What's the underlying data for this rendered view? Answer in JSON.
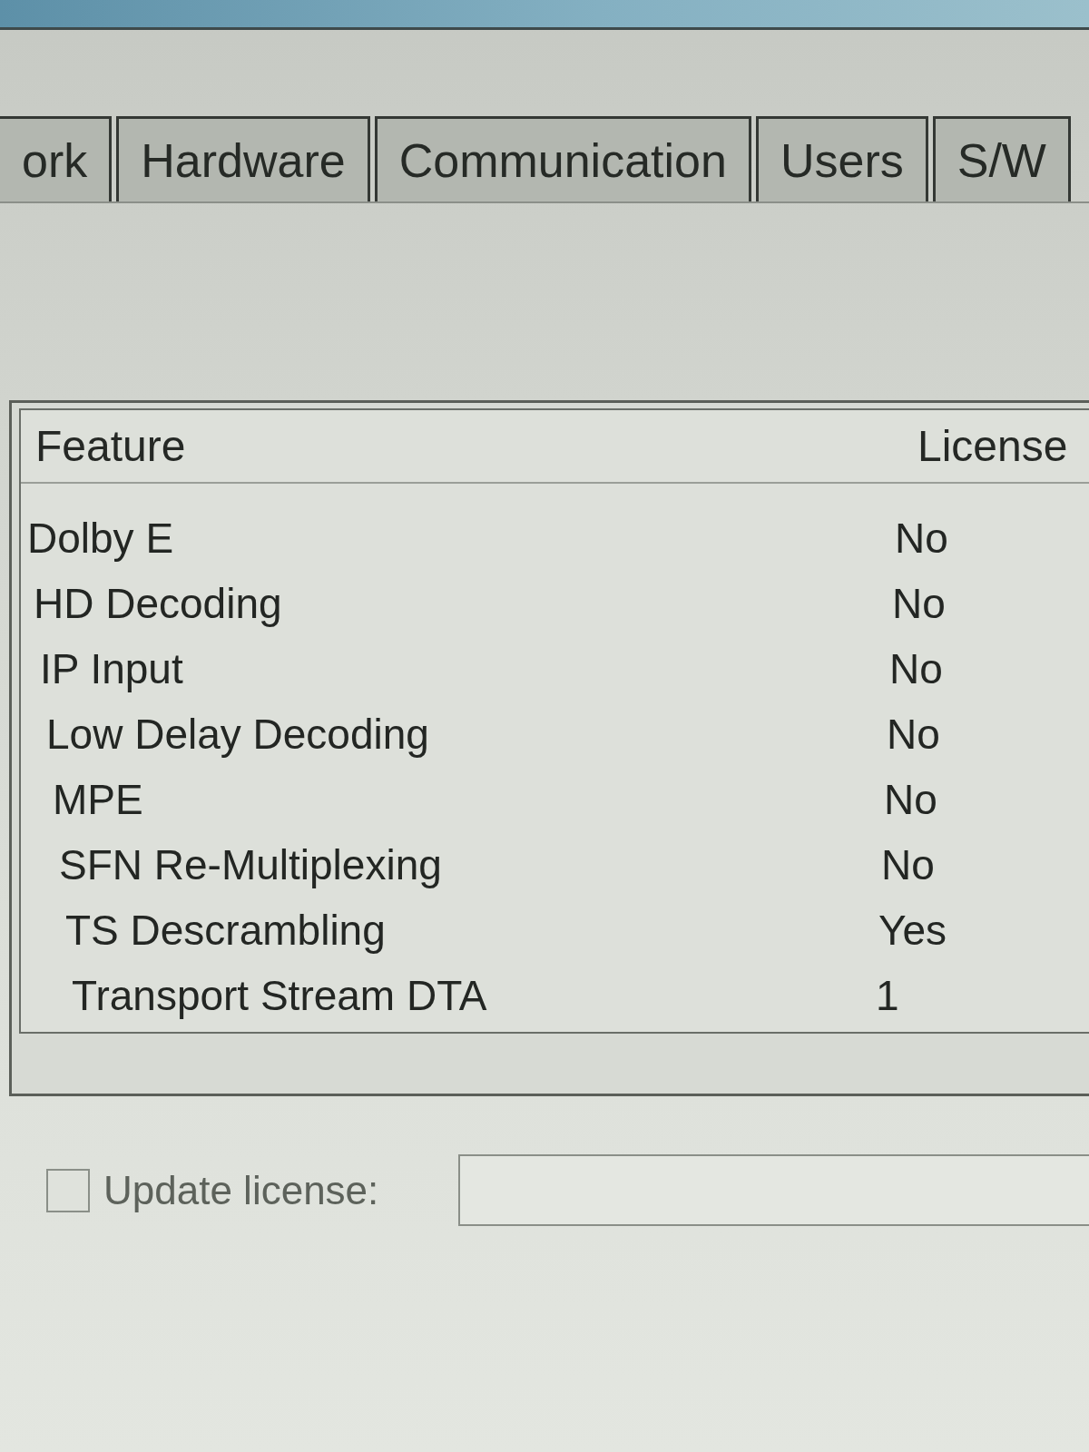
{
  "tabs": [
    {
      "label": "ork"
    },
    {
      "label": "Hardware"
    },
    {
      "label": "Communication"
    },
    {
      "label": "Users"
    },
    {
      "label": "S/W"
    }
  ],
  "features_table": {
    "columns": [
      "Feature",
      "License"
    ],
    "rows": [
      [
        "Dolby E",
        "No"
      ],
      [
        "HD Decoding",
        "No"
      ],
      [
        "IP Input",
        "No"
      ],
      [
        "Low Delay Decoding",
        "No"
      ],
      [
        "MPE",
        "No"
      ],
      [
        "SFN Re-Multiplexing",
        "No"
      ],
      [
        "TS Descrambling",
        "Yes"
      ],
      [
        "Transport Stream DTA",
        "1"
      ]
    ]
  },
  "update_license": {
    "label": "Update license:",
    "checked": false
  }
}
